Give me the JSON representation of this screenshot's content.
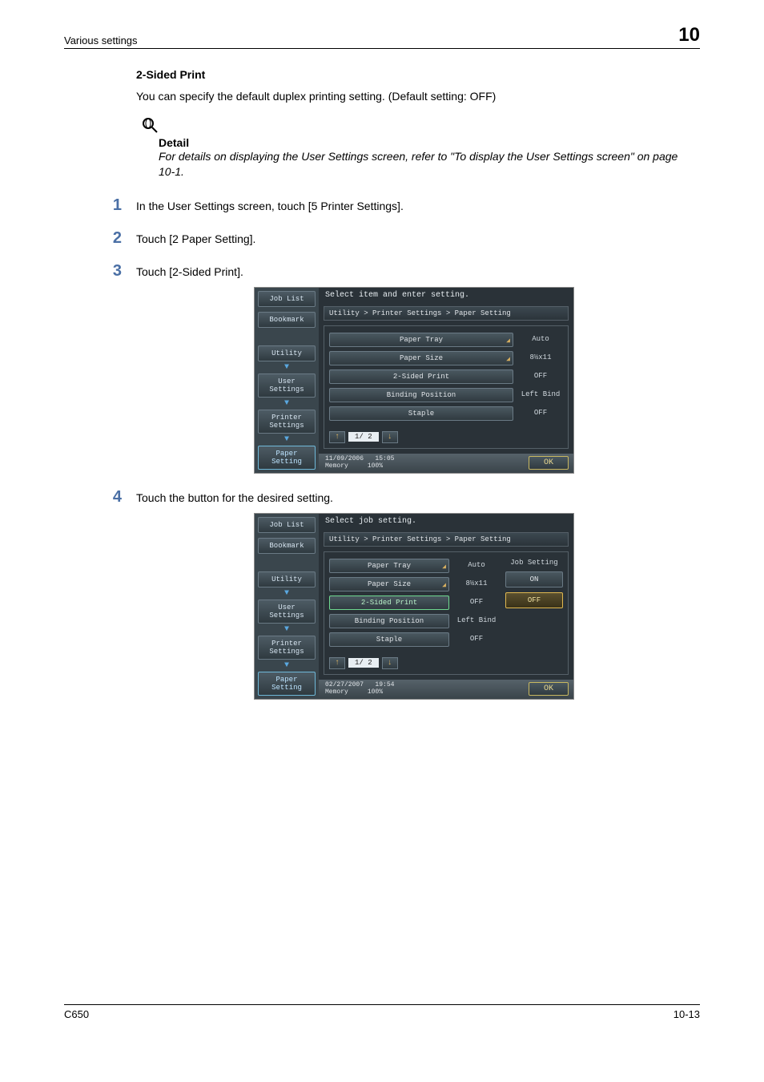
{
  "header": {
    "left": "Various settings",
    "right": "10"
  },
  "sectionTitle": "2-Sided Print",
  "intro": "You can specify the default duplex printing setting. (Default setting: OFF)",
  "detail": {
    "label": "Detail",
    "body": "For details on displaying the User Settings screen, refer to \"To display the User Settings screen\" on page 10-1."
  },
  "steps": {
    "s1": {
      "num": "1",
      "text": "In the User Settings screen, touch [5 Printer Settings]."
    },
    "s2": {
      "num": "2",
      "text": "Touch [2 Paper Setting]."
    },
    "s3": {
      "num": "3",
      "text": "Touch [2-Sided Print]."
    },
    "s4": {
      "num": "4",
      "text": "Touch the button for the desired setting."
    }
  },
  "ss1": {
    "tabs": {
      "joblist": "Job List",
      "bookmark": "Bookmark"
    },
    "side": {
      "utility": "Utility",
      "userSettings": "User Settings",
      "printerSettings": "Printer Settings",
      "paperSetting": "Paper Setting"
    },
    "title": "Select item and enter setting.",
    "crumb": "Utility > Printer Settings > Paper Setting",
    "rows": {
      "r1": {
        "label": "Paper Tray",
        "val": "Auto",
        "drop": true
      },
      "r2": {
        "label": "Paper Size",
        "val": "8½x11",
        "drop": true
      },
      "r3": {
        "label": "2-Sided Print",
        "val": "OFF"
      },
      "r4": {
        "label": "Binding Position",
        "val": "Left Bind"
      },
      "r5": {
        "label": "Staple",
        "val": "OFF"
      }
    },
    "pager": {
      "up": "↑",
      "ind": "1/ 2",
      "down": "↓"
    },
    "meta": {
      "date": "11/09/2006",
      "time": "15:05",
      "memLabel": "Memory",
      "memVal": "100%"
    },
    "ok": "OK"
  },
  "ss2": {
    "tabs": {
      "joblist": "Job List",
      "bookmark": "Bookmark"
    },
    "side": {
      "utility": "Utility",
      "userSettings": "User Settings",
      "printerSettings": "Printer Settings",
      "paperSetting": "Paper Setting"
    },
    "title": "Select job setting.",
    "crumb": "Utility > Printer Settings > Paper Setting",
    "rows": {
      "r1": {
        "label": "Paper Tray",
        "val": "Auto",
        "drop": true
      },
      "r2": {
        "label": "Paper Size",
        "val": "8½x11",
        "drop": true
      },
      "r3": {
        "label": "2-Sided Print",
        "val": "OFF",
        "selected": true
      },
      "r4": {
        "label": "Binding Position",
        "val": "Left Bind"
      },
      "r5": {
        "label": "Staple",
        "val": "OFF"
      }
    },
    "pager": {
      "up": "↑",
      "ind": "1/ 2",
      "down": "↓"
    },
    "panel": {
      "heading": "Job Setting",
      "on": "ON",
      "off": "OFF"
    },
    "meta": {
      "date": "02/27/2007",
      "time": "19:54",
      "memLabel": "Memory",
      "memVal": "100%"
    },
    "ok": "OK"
  },
  "footer": {
    "left": "C650",
    "right": "10-13"
  }
}
